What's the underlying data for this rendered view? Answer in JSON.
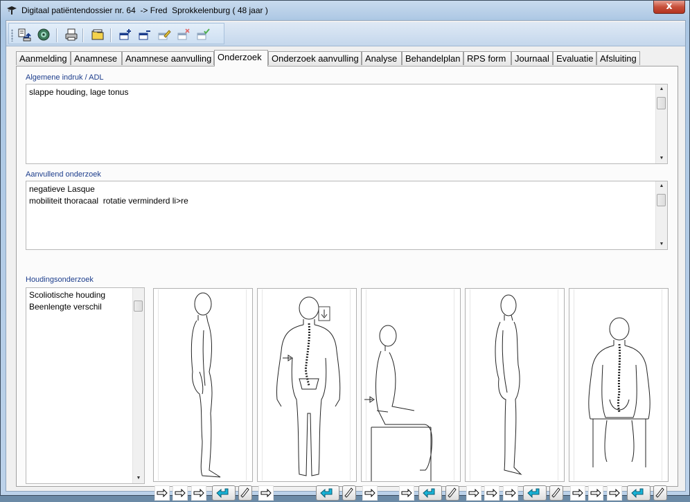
{
  "window": {
    "title": "Digitaal patiëntendossier nr. 64  -> Fred  Sprokkelenburg ( 48 jaar )",
    "close_glyph": "x"
  },
  "toolbar": {
    "buttons": [
      {
        "name": "import-icon"
      },
      {
        "name": "gear-icon"
      },
      {
        "name": "print-icon"
      },
      {
        "name": "folder-icon"
      },
      {
        "name": "add-record-icon"
      },
      {
        "name": "remove-record-icon"
      },
      {
        "name": "edit-record-icon"
      },
      {
        "name": "delete-record-icon"
      },
      {
        "name": "confirm-record-icon"
      }
    ]
  },
  "tabs": [
    {
      "label": "Aanmelding"
    },
    {
      "label": "Anamnese"
    },
    {
      "label": "Anamnese aanvulling"
    },
    {
      "label": "Onderzoek",
      "active": true
    },
    {
      "label": "Onderzoek aanvulling"
    },
    {
      "label": "Analyse"
    },
    {
      "label": "Behandelplan"
    },
    {
      "label": "RPS form"
    },
    {
      "label": "Journaal"
    },
    {
      "label": "Evaluatie"
    },
    {
      "label": "Afsluiting"
    }
  ],
  "sections": {
    "general": {
      "label": "Algemene indruk / ADL",
      "lines": [
        "slappe houding, lage tonus"
      ]
    },
    "additional": {
      "label": "Aanvullend onderzoek",
      "lines": [
        "negatieve Lasque",
        "mobiliteit thoracaal  rotatie verminderd li>re"
      ]
    },
    "posture": {
      "label": "Houdingsonderzoek",
      "items": [
        "Scoliotische houding",
        "Beenlengte verschil"
      ]
    }
  },
  "figures": [
    {
      "name": "lateral-standing-figure",
      "arrows": 3
    },
    {
      "name": "posterior-spine-figure",
      "arrows": 1
    },
    {
      "name": "seated-figure",
      "arrows": 2
    },
    {
      "name": "lateral-standing-figure-2",
      "arrows": 3
    },
    {
      "name": "seated-posterior-figure",
      "arrows": 3
    }
  ],
  "colors": {
    "accent_label": "#1c3d8c",
    "return_button_icon": "#18b4d8",
    "close_button": "#c7503a"
  }
}
